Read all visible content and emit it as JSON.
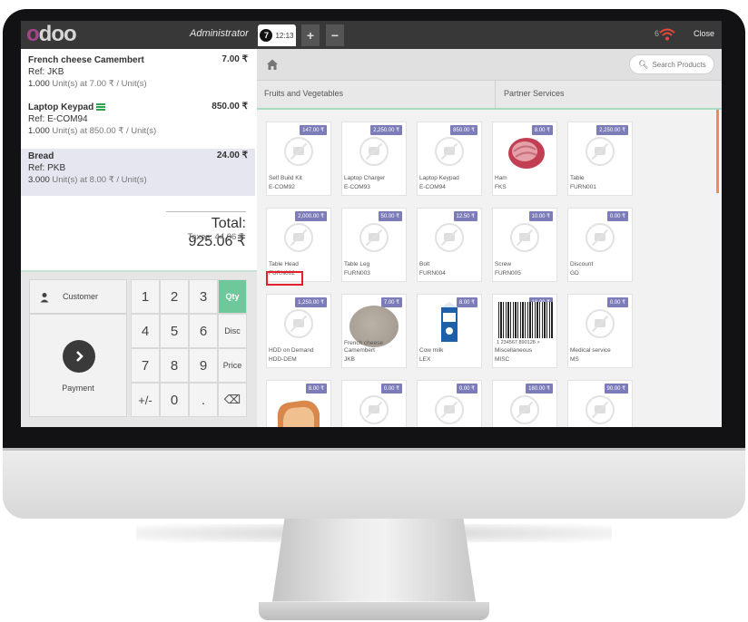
{
  "topbar": {
    "logo": "odoo",
    "user": "Administrator",
    "order_number": "7",
    "order_time": "12:13",
    "add_label": "+",
    "remove_label": "−",
    "close_label": "Close",
    "wifi_count": "6"
  },
  "order": {
    "lines": [
      {
        "name": "French cheese Camembert",
        "ref": "Ref: JKB",
        "qty": "1.000",
        "detail": "Unit(s) at 7.00 ₹ / Unit(s)",
        "price": "7.00 ₹"
      },
      {
        "name": "Laptop Keypad",
        "ref": "Ref: E-COM94",
        "qty": "1.000",
        "detail": "Unit(s) at 850.00 ₹ / Unit(s)",
        "price": "850.00 ₹"
      },
      {
        "name": "Bread",
        "ref": "Ref: PKB",
        "qty": "3.000",
        "detail": "Unit(s) at 8.00 ₹ / Unit(s)",
        "price": "24.00 ₹"
      }
    ],
    "total": "Total: 925.06 ₹",
    "taxes": "Taxes: 44.06 ₹"
  },
  "numpad": {
    "customer_label": "Customer",
    "payment_label": "Payment",
    "keys": [
      "1",
      "2",
      "3",
      "4",
      "5",
      "6",
      "7",
      "8",
      "9",
      "+/-",
      "0",
      "."
    ],
    "qty_label": "Qty",
    "disc_label": "Disc",
    "price_label": "Price",
    "backspace": "⌫"
  },
  "products_header": {
    "search_placeholder": "Search Products",
    "categories": [
      "Fruits and Vegetables",
      "Partner Services"
    ]
  },
  "products": [
    {
      "price": "147.00 ₹",
      "name": "Self Build Kit",
      "ref": "E-COM92"
    },
    {
      "price": "2,250.00 ₹",
      "name": "Laptop Charger",
      "ref": "E-COM93"
    },
    {
      "price": "850.00 ₹",
      "name": "Laptop Keypad",
      "ref": "E-COM94"
    },
    {
      "price": "8.00 ₹",
      "name": "Ham",
      "ref": "FKS"
    },
    {
      "price": "2,250.00 ₹",
      "name": "Table",
      "ref": "FURN001"
    },
    {
      "price": "2,000.00 ₹",
      "name": "Table Head",
      "ref": "FURN002"
    },
    {
      "price": "50.00 ₹",
      "name": "Table Leg",
      "ref": "FURN003"
    },
    {
      "price": "12.50 ₹",
      "name": "Bolt",
      "ref": "FURN004"
    },
    {
      "price": "10.00 ₹",
      "name": "Screw",
      "ref": "FURN005"
    },
    {
      "price": "0.00 ₹",
      "name": "Discount",
      "ref": "GD"
    },
    {
      "price": "1,250.00 ₹",
      "name": "HDD on Demand",
      "ref": "HDD-DEM"
    },
    {
      "price": "7.00 ₹",
      "name": "French cheese Camembert",
      "ref": "JKB"
    },
    {
      "price": "8.00 ₹",
      "name": "Cow milk",
      "ref": "LEX"
    },
    {
      "price": "18.00 ₹",
      "name": "Miscellaneous",
      "ref": "MISC"
    },
    {
      "price": "0.00 ₹",
      "name": "Medical service",
      "ref": "MS"
    },
    {
      "price": "8.00 ₹"
    },
    {
      "price": "0.00 ₹"
    },
    {
      "price": "0.00 ₹"
    },
    {
      "price": "180.00 ₹"
    },
    {
      "price": "90.00 ₹"
    }
  ],
  "barcode_text": "1 234567 890128 >",
  "colors": {
    "accent": "#6ec89b",
    "badge": "#7c7cb8",
    "topbar": "#383838",
    "highlight": "#e0202a"
  }
}
